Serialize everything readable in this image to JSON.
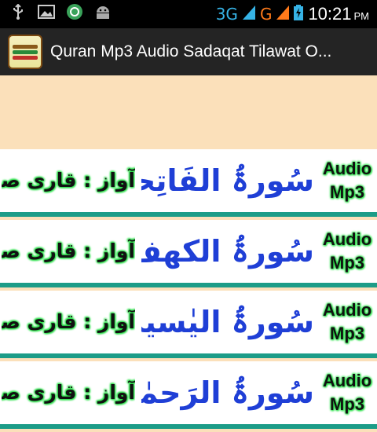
{
  "status_bar": {
    "network_3g": "3G",
    "network_g": "G",
    "time": "10:21",
    "ampm": "PM",
    "icons": [
      "usb-icon",
      "image-icon",
      "sync-icon",
      "android-icon",
      "signal-icon",
      "battery-charging-icon"
    ]
  },
  "app_bar": {
    "title": "Quran Mp3 Audio Sadaqat Tilawat O..."
  },
  "surahs": [
    {
      "name": "سُورۃُ الفَاتِحہ",
      "reciter": "آواز : قاری صداقت علی",
      "badge_line1": "Audio",
      "badge_line2": "Mp3"
    },
    {
      "name": "سُورۃُ الکھف",
      "reciter": "آواز : قاری صداقت علی",
      "badge_line1": "Audio",
      "badge_line2": "Mp3"
    },
    {
      "name": "سُورۃُ الیٰسین",
      "reciter": "آواز : قاری صداقت علی",
      "badge_line1": "Audio",
      "badge_line2": "Mp3"
    },
    {
      "name": "سُورۃُ الرَحمٰن",
      "reciter": "آواز : قاری صداقت علی",
      "badge_line1": "Audio",
      "badge_line2": "Mp3"
    }
  ],
  "colors": {
    "background": "#fbe0ba",
    "row_border": "#1c9c88",
    "surah_text": "#1f3fd6",
    "glow": "#2be04a"
  }
}
